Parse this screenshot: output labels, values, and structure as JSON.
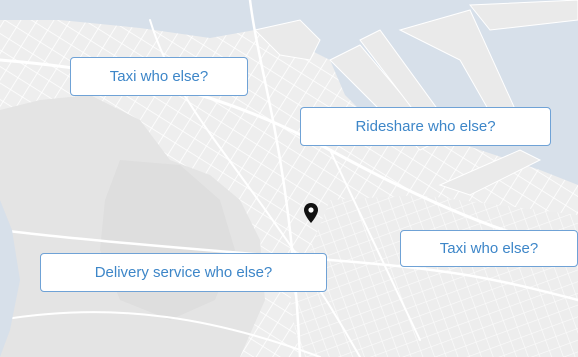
{
  "map": {
    "pin_icon": "map-pin-icon",
    "colors": {
      "water": "#d7e0ea",
      "land": "#f1f1f1",
      "park": "#e4e4e4",
      "road": "#ffffff",
      "callout_border": "#6fa2d6",
      "callout_text": "#3d86c8",
      "pin": "#111111"
    }
  },
  "callouts": [
    {
      "label": "Taxi who else?"
    },
    {
      "label": "Rideshare who else?"
    },
    {
      "label": "Taxi who else?"
    },
    {
      "label": "Delivery service who else?"
    }
  ]
}
